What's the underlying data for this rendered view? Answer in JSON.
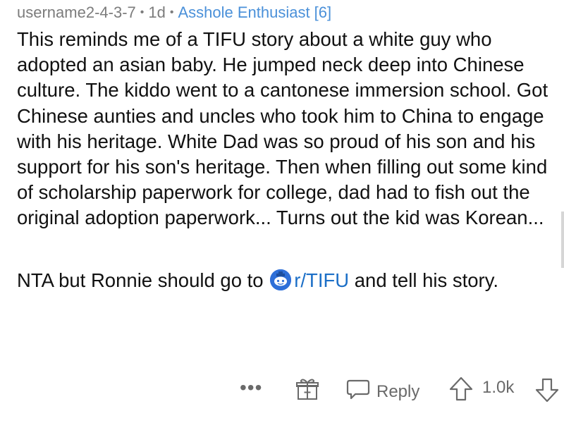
{
  "comment": {
    "username": "username2-4-3-7",
    "age": "1d",
    "flair": "Asshole Enthusiast [6]",
    "separator": "•",
    "body_paragraph_1": "This reminds me of a TIFU story about a white guy who adopted an asian baby. He jumped neck deep into Chinese culture. The kiddo went to a cantonese immersion school. Got Chinese aunties and uncles who took him to China to engage with his heritage. White Dad was so proud of his son and his support for his son's heritage. Then when filling out some kind of scholarship paperwork for college, dad had to fish out the original adoption paperwork... Turns out the kid was Korean...",
    "body_paragraph_2_before": "NTA but Ronnie should go to ",
    "subreddit_link": "r/TIFU",
    "body_paragraph_2_after": " and tell his story."
  },
  "actions": {
    "more_label": "•••",
    "reply_label": "Reply",
    "score": "1.0k"
  },
  "icons": {
    "subreddit": "subreddit-avatar-icon",
    "award": "gift-award-icon",
    "reply": "speech-bubble-icon",
    "upvote": "upvote-arrow-icon",
    "downvote": "downvote-arrow-icon"
  },
  "colors": {
    "flair": "#4a90d9",
    "link": "#1c6fc7",
    "subreddit_icon_bg": "#2e6fd8",
    "muted": "#6a6a6a"
  }
}
